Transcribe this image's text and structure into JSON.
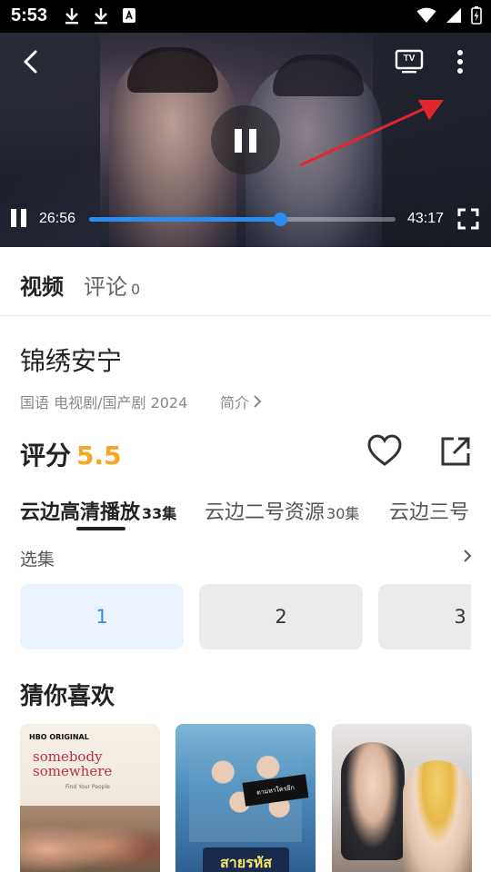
{
  "status_bar": {
    "time": "5:53",
    "icons_left": [
      "download-icon",
      "download-icon",
      "app-a-icon"
    ],
    "icons_right": [
      "wifi-icon",
      "signal-icon",
      "battery-charging-icon"
    ]
  },
  "player": {
    "current_time": "26:56",
    "total_time": "43:17",
    "progress_fraction": 0.622,
    "accent_color": "#2b8cf0",
    "icons": [
      "back-icon",
      "tv-cast-icon",
      "more-icon",
      "pause-icon",
      "fullscreen-icon"
    ],
    "tv_label": "TV"
  },
  "tabs": {
    "video": "视频",
    "comment": "评论",
    "comment_count": "0"
  },
  "info": {
    "title": "锦绣安宁",
    "meta": "国语  电视剧/国产剧  2024",
    "intro": "简介",
    "rating_label": "评分",
    "rating_value": "5.5",
    "rating_color": "#f5a623"
  },
  "sources": [
    {
      "name": "云边高清播放",
      "count": "33集",
      "active": true
    },
    {
      "name": "云边二号资源",
      "count": "30集",
      "active": false
    },
    {
      "name": "云边三号",
      "count": "",
      "active": false
    }
  ],
  "episodes": {
    "label": "选集",
    "items": [
      "1",
      "2",
      "3"
    ],
    "active_index": 0
  },
  "recommend": {
    "title": "猜你喜欢",
    "items": [
      {
        "brand": "HBO ORIGINAL",
        "poster_title": "somebody somewhere",
        "tagline": "Find Your People"
      },
      {
        "poster_title": "สายรหัส",
        "banner": "ตามหาใครอีก"
      },
      {
        "poster_title": ""
      }
    ]
  }
}
